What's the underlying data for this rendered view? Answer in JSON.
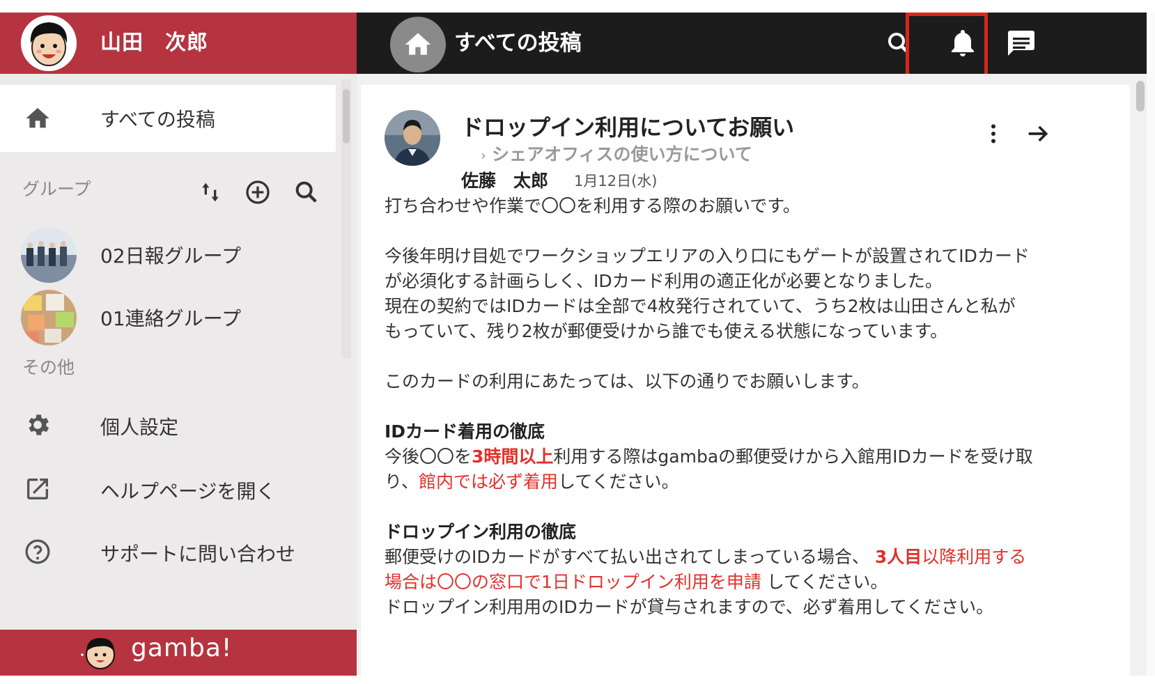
{
  "user": {
    "name": "山田　次郎"
  },
  "topbar": {
    "title": "すべての投稿",
    "icons": [
      "search-icon",
      "bell-icon",
      "message-icon"
    ]
  },
  "sidebar": {
    "all_posts": "すべての投稿",
    "groups_label": "グループ",
    "groups": [
      {
        "name": "02日報グループ"
      },
      {
        "name": "01連絡グループ"
      }
    ],
    "other_label": "その他",
    "other": [
      {
        "label": "個人設定",
        "icon": "gear-icon"
      },
      {
        "label": "ヘルプページを開く",
        "icon": "open-external-icon"
      },
      {
        "label": "サポートに問い合わせ",
        "icon": "help-circle-icon"
      }
    ],
    "brand": "gamba!"
  },
  "post": {
    "title": "ドロップイン利用についてお願い",
    "group": "シェアオフィスの使い方について",
    "group_chevron": "›",
    "author": "佐藤　太郎",
    "date": "1月12日(水)",
    "line1": "打ち合わせや作業で〇〇を利用する際のお願いです。",
    "line2": "今後年明け目処でワークショップエリアの入り口にもゲートが設置されてIDカード",
    "line3": "が必須化する計画らしく、IDカード利用の適正化が必要となりました。",
    "line4": "現在の契約ではIDカードは全部で4枚発行されていて、うち2枚は山田さんと私が",
    "line5": "もっていて、残り2枚が郵便受けから誰でも使える状態になっています。",
    "line6": "このカードの利用にあたっては、以下の通りでお願いします。",
    "h1": "IDカード着用の徹底",
    "s1a": "今後〇〇を",
    "s1b": "3時間以上",
    "s1c": "利用する際はgambaの郵便受けから入館用IDカードを受け取",
    "s1d": "り、",
    "s1e": "館内では必ず着用",
    "s1f": "してください。",
    "h2": "ドロップイン利用の徹底",
    "s2a": "郵便受けのIDカードがすべて払い出されてしまっている場合、",
    "s2b": "3人目",
    "s2c": "以降利用する",
    "s2d": "場合は〇〇の窓口で1日ドロップイン利用を申請",
    "s2e": "してください。",
    "s2f": "ドロップイン利用用のIDカードが貸与されますので、必ず着用してください。"
  },
  "colors": {
    "brand_red": "#b5343f",
    "topbar": "#1c1c1c",
    "highlight": "#d9261c",
    "emphasis_red": "#e0302a"
  }
}
